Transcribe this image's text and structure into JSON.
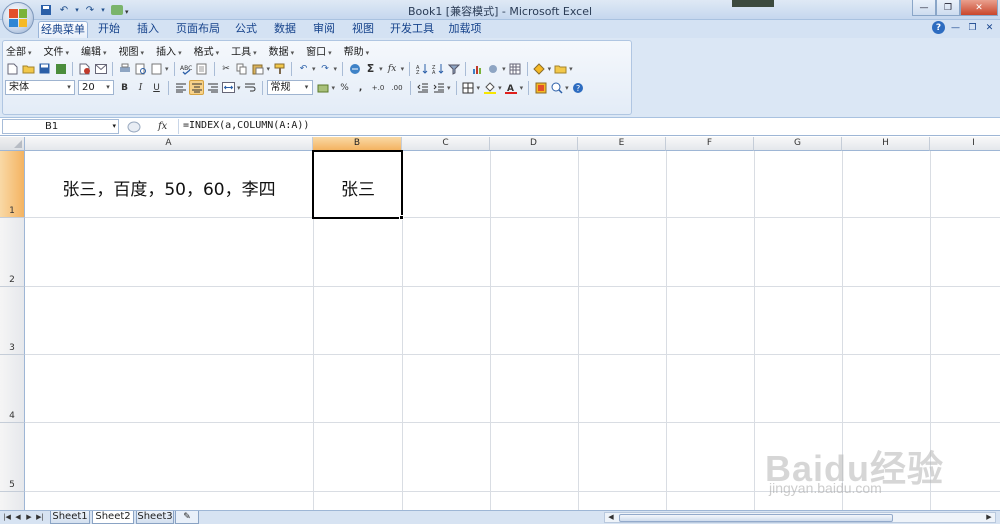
{
  "window": {
    "title": "Book1  [兼容模式] - Microsoft Excel"
  },
  "ribbon_tabs": [
    "经典菜单",
    "开始",
    "插入",
    "页面布局",
    "公式",
    "数据",
    "审阅",
    "视图",
    "开发工具",
    "加载项"
  ],
  "active_tab_index": 0,
  "classic_menu": [
    "全部",
    "文件",
    "编辑",
    "视图",
    "插入",
    "格式",
    "工具",
    "数据",
    "窗口",
    "帮助"
  ],
  "toolbar": {
    "font_name": "宋体",
    "font_size": "20",
    "bold": "B",
    "italic": "I",
    "underline": "U",
    "number_format": "常规",
    "percent": "%",
    "comma": ",",
    "increase_decimal": "+.0",
    "decrease_decimal": ".00",
    "sigma": "Σ",
    "fx": "fx"
  },
  "formula_bar": {
    "name_box": "B1",
    "fx_label": "fx",
    "formula": "=INDEX(a,COLUMN(A:A))"
  },
  "columns": [
    "A",
    "B",
    "C",
    "D",
    "E",
    "F",
    "G",
    "H",
    "I"
  ],
  "rows": [
    "1",
    "2",
    "3",
    "4",
    "5"
  ],
  "selected_cell": {
    "col": "B",
    "row": "1"
  },
  "cells": {
    "A1": "张三，百度，50，60，李四",
    "B1": "张三"
  },
  "sheets": [
    "Sheet1",
    "Sheet2",
    "Sheet3"
  ],
  "active_sheet": "Sheet2",
  "watermark": {
    "logo": "Baidu经验",
    "url": "jingyan.baidu.com"
  },
  "colors": {
    "selected_header": "#f4b361",
    "ribbon_bg": "#dbe7f5",
    "gridline": "#d9dde3"
  }
}
